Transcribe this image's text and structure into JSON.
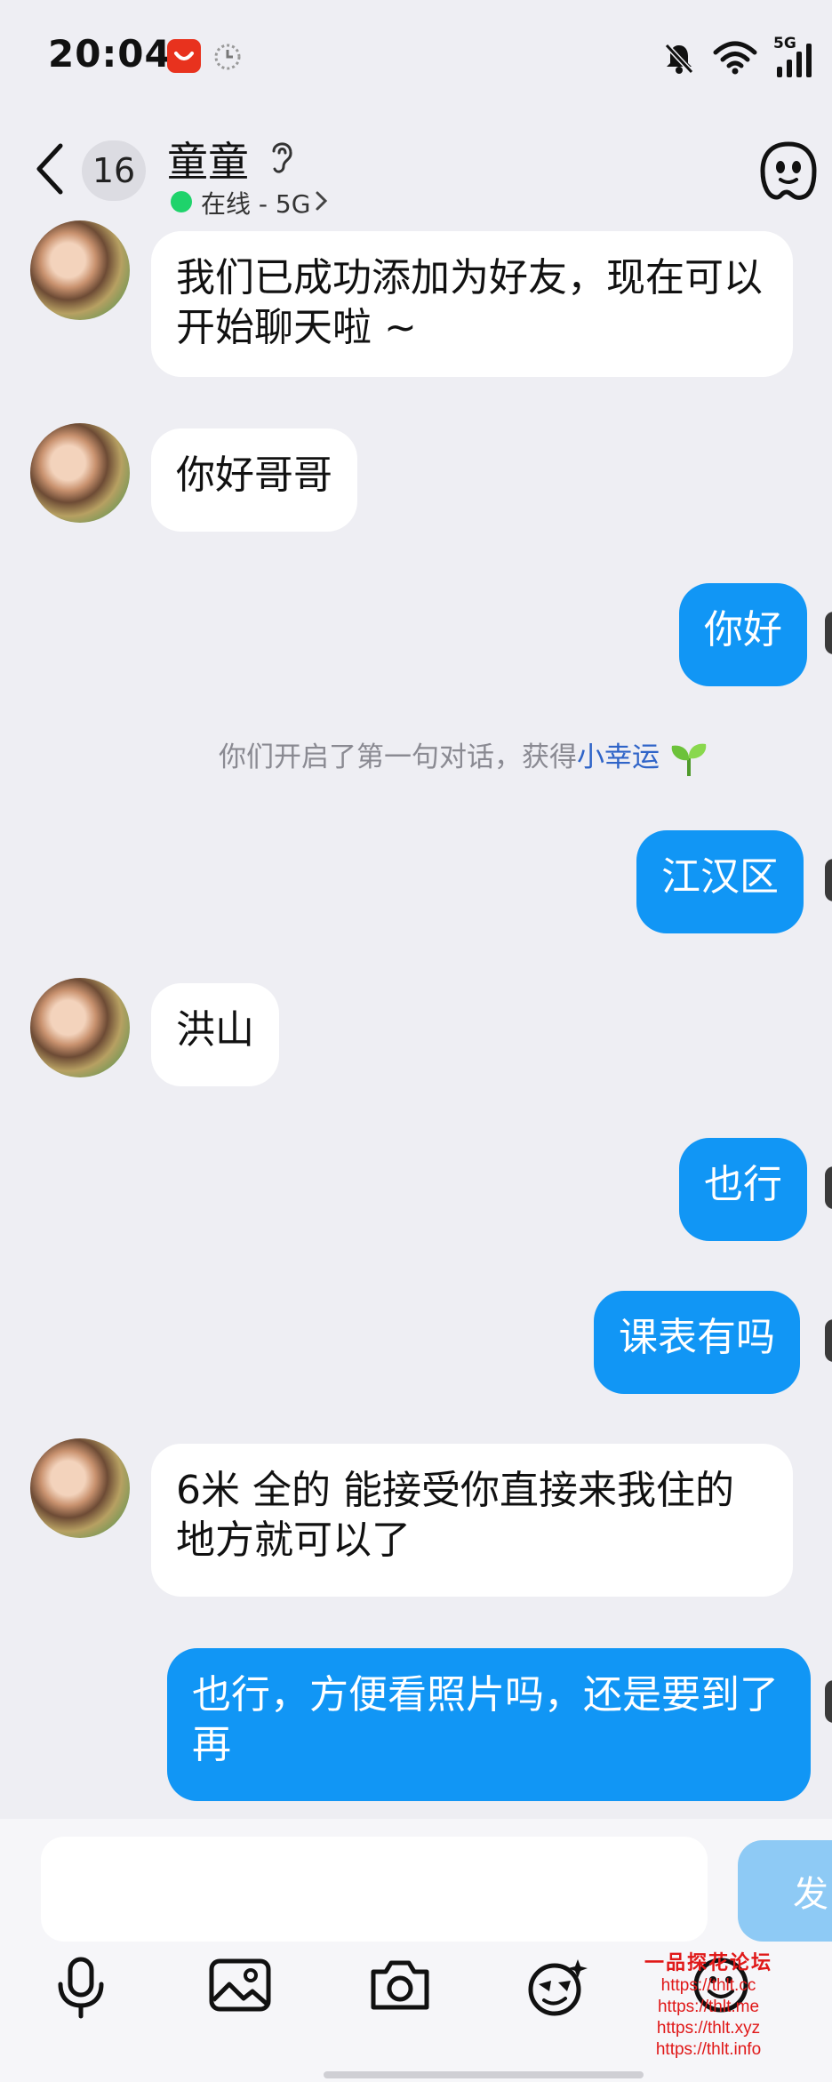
{
  "status_bar": {
    "time": "20:04",
    "network": "5G"
  },
  "header": {
    "unread_count": "16",
    "contact_name": "童童",
    "status": "在线 - 5G",
    "status_color": "#1fd36b"
  },
  "messages": [
    {
      "side": "in",
      "text": "我们已成功添加为好友，现在可以开始聊天啦 ~"
    },
    {
      "side": "in",
      "text": "你好哥哥"
    },
    {
      "side": "out",
      "text": "你好"
    },
    {
      "side": "out",
      "text": "江汉区"
    },
    {
      "side": "in",
      "text": "洪山"
    },
    {
      "side": "out",
      "text": "也行"
    },
    {
      "side": "out",
      "text": "课表有吗"
    },
    {
      "side": "in",
      "text": "6米  全的 能接受你直接来我住的地方就可以了"
    },
    {
      "side": "out",
      "text": "也行，方便看照片吗，还是要到了再"
    }
  ],
  "notice": {
    "text": "你们开启了第一句对话，获得",
    "link": "小幸运"
  },
  "composer": {
    "input_value": "",
    "send_label": "发"
  },
  "toolbar": [
    "microphone-icon",
    "image-icon",
    "camera-icon",
    "sticker-icon",
    "emoji-icon"
  ],
  "watermark": {
    "title": "一品探花论坛",
    "lines": [
      "https://thlt.cc",
      "https://thlt.me",
      "https://thlt.xyz",
      "https://thlt.info"
    ]
  },
  "colors": {
    "outgoing_bubble": "#1196f5",
    "incoming_bubble": "#ffffff",
    "background": "#eeeef3",
    "watermark": "#e01818"
  }
}
